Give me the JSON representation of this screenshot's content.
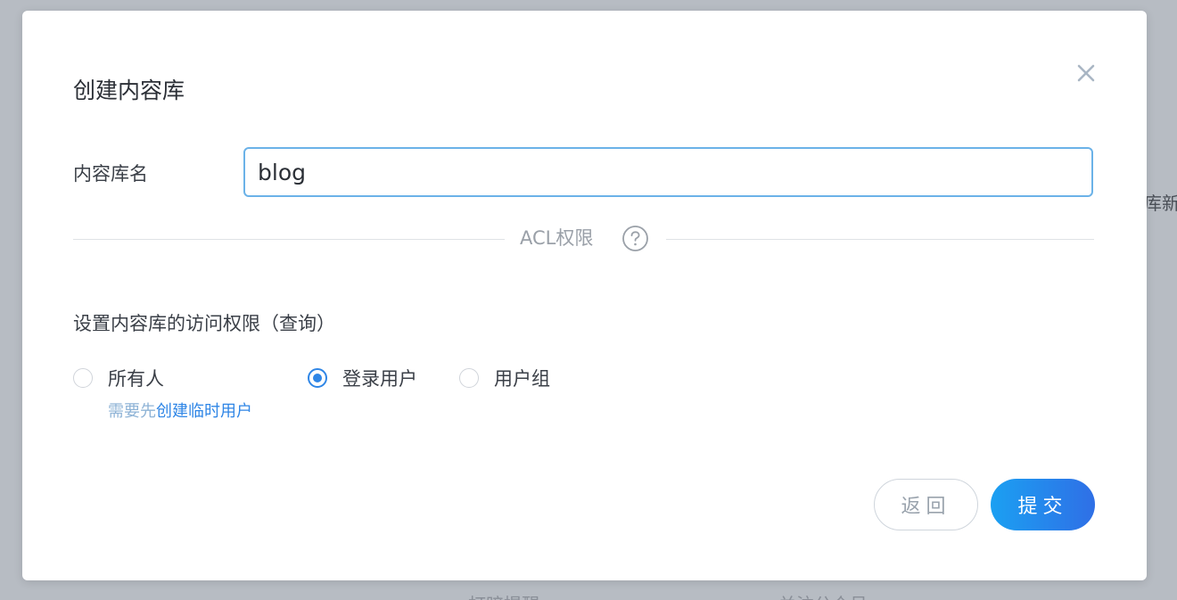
{
  "background": {
    "right_fragment": "库新",
    "bottom_fragment_1": "打暗提醒",
    "bottom_fragment_2": "关注公众号"
  },
  "dialog": {
    "title": "创建内容库",
    "close_icon": "close-icon",
    "name_field": {
      "label": "内容库名",
      "value": "blog"
    },
    "acl_divider": {
      "text": "ACL权限",
      "help_icon": "question-circle-icon"
    },
    "acl_description": "设置内容库的访问权限（查询）",
    "radio_options": [
      {
        "label": "所有人",
        "checked": false
      },
      {
        "label": "登录用户",
        "checked": true
      },
      {
        "label": "用户组",
        "checked": false
      }
    ],
    "hint": {
      "prefix": "需要先",
      "link": "创建临时用户"
    },
    "buttons": {
      "back": "返回",
      "submit": "提交"
    },
    "colors": {
      "accent": "#2f86e6",
      "submit_gradient_start": "#1ba0f2",
      "submit_gradient_end": "#2f6fe6",
      "input_border": "#6bb2e8",
      "overlay": "#b7bcc3"
    }
  }
}
